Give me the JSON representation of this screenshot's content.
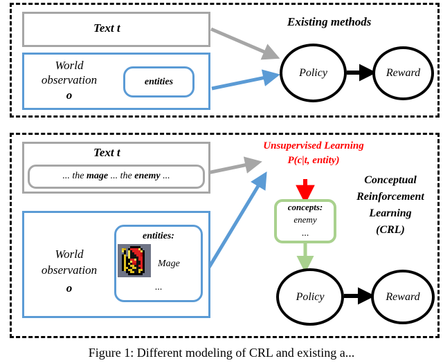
{
  "figure": {
    "caption": "Figure 1: Different modeling of CRL and existing a..."
  },
  "top_panel": {
    "label": "Existing methods",
    "text_box": {
      "label": "Text t"
    },
    "observation_box": {
      "label_line1": "World",
      "label_line2": "observation",
      "label_line3": "o",
      "entities_box": {
        "label": "entities"
      }
    },
    "policy_node": {
      "label": "Policy"
    },
    "reward_node": {
      "label": "Reward"
    },
    "arrows": [
      {
        "name": "text-to-policy",
        "color": "#a6a6a6"
      },
      {
        "name": "entities-to-policy",
        "color": "#5b9bd5"
      },
      {
        "name": "policy-to-reward",
        "color": "#000000"
      }
    ]
  },
  "bottom_panel": {
    "label_line1": "Conceptual",
    "label_line2": "Reinforcement",
    "label_line3": "Learning",
    "label_line4": "(CRL)",
    "text_box": {
      "label": "Text t",
      "sentence_parts": [
        {
          "text": "... ",
          "bold": false
        },
        {
          "text": "the ",
          "bold": false
        },
        {
          "text": "mage",
          "bold": true
        },
        {
          "text": " ... ",
          "bold": false
        },
        {
          "text": "the ",
          "bold": false
        },
        {
          "text": "enemy",
          "bold": true
        },
        {
          "text": " ...",
          "bold": false
        }
      ]
    },
    "observation_box": {
      "label_line1": "World",
      "label_line2": "observation",
      "label_line3": "o",
      "entities_box": {
        "label": "entities:",
        "entity_name": "Mage",
        "ellipsis": "..."
      }
    },
    "unsupervised": {
      "line1": "Unsupervised Learning",
      "line2": "P(c|t, entity)",
      "color": "#ff0000"
    },
    "concepts_box": {
      "label": "concepts:",
      "item": "enemy",
      "ellipsis": "...",
      "color": "#a9d18e"
    },
    "policy_node": {
      "label": "Policy"
    },
    "reward_node": {
      "label": "Reward"
    },
    "arrows": [
      {
        "name": "text-to-unsupervised",
        "color": "#a6a6a6"
      },
      {
        "name": "entities-to-unsupervised",
        "color": "#5b9bd5"
      },
      {
        "name": "unsupervised-to-concepts",
        "color": "#ff0000"
      },
      {
        "name": "concepts-to-policy",
        "color": "#a9d18e"
      },
      {
        "name": "policy-to-reward",
        "color": "#000000"
      }
    ]
  }
}
